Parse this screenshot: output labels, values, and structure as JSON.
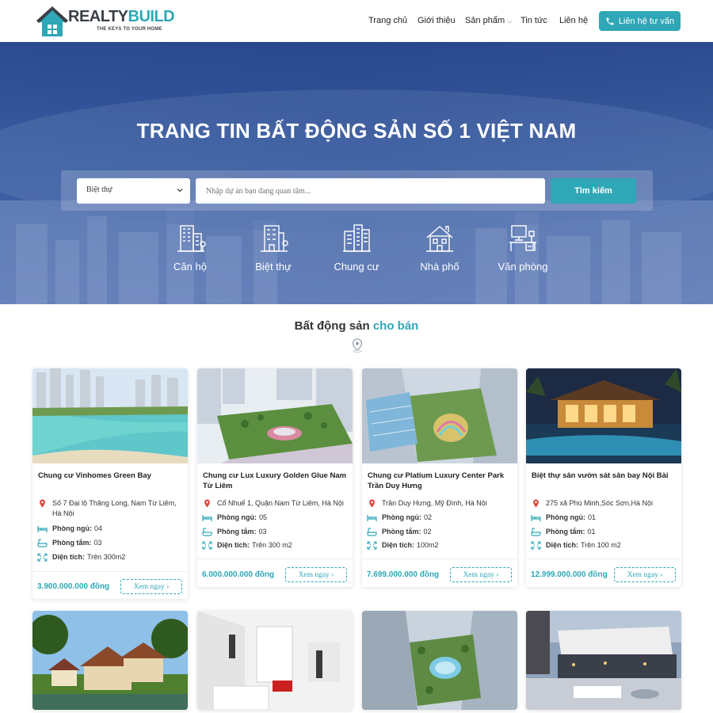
{
  "brand": {
    "word1": "REALTY",
    "word2": "BUILD",
    "tagline": "THE KEYS TO YOUR HOME"
  },
  "nav": {
    "items": [
      "Trang chủ",
      "Giới thiệu",
      "Sản phẩm",
      "Tin tức",
      "Liên hệ"
    ],
    "cta": "Liên hệ tư vấn"
  },
  "hero": {
    "title": "TRANG TIN BẤT ĐỘNG SẢN SỐ 1 VIỆT NAM",
    "select_value": "Biệt thự",
    "search_placeholder": "Nhập dự án bạn đang quan tâm...",
    "search_button": "Tìm kiếm",
    "categories": [
      "Căn hộ",
      "Biệt thự",
      "Chung cư",
      "Nhà phố",
      "Văn phòng"
    ]
  },
  "section": {
    "title_prefix": "Bất động sản",
    "title_accent": "cho bán"
  },
  "listing_labels": {
    "bedrooms": "Phòng ngủ:",
    "bathrooms": "Phòng tắm:",
    "area": "Diện tích:",
    "more": "Xem ngay ›"
  },
  "listings": [
    {
      "title": "Chung cư Vinhomes Green Bay",
      "address": "Số 7 Đại lộ Thăng Long, Nam Từ Liêm, Hà Nội",
      "bedrooms": "04",
      "bathrooms": "03",
      "area": "Trên 300m2",
      "price": "3.900.000.000 đồng"
    },
    {
      "title": "Chung cư Lux Luxury Golden Glue Nam Từ Liêm",
      "address": "Cổ Nhuế 1, Quận Nam Từ Liêm, Hà Nội",
      "bedrooms": "05",
      "bathrooms": "03",
      "area": "Trên 300 m2",
      "price": "6.000.000.000 đồng"
    },
    {
      "title": "Chung cư Platium Luxury Center Park Trần Duy Hưng",
      "address": "Trần Duy Hưng, Mỹ Đình, Hà Nội",
      "bedrooms": "02",
      "bathrooms": "02",
      "area": "100m2",
      "price": "7.699.000.000 đồng"
    },
    {
      "title": "Biệt thự sân vườn sát sân bay Nội Bài",
      "address": "275 xã Phú Minh,Sóc Sơn,Hà Nội",
      "bedrooms": "01",
      "bathrooms": "01",
      "area": "Trên 100 m2",
      "price": "12.999.000.000 đồng"
    }
  ],
  "colors": {
    "accent": "#2fa7b6",
    "hero": "#2e4f96",
    "pin": "#e0443a"
  }
}
